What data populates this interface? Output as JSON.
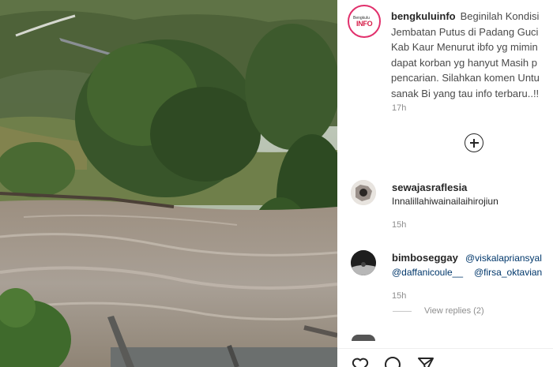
{
  "post": {
    "photo_label": "flooded river photo",
    "account": {
      "username": "bengkuluinfo",
      "brand_top": "Bengkulu",
      "brand_bottom": "INFO"
    },
    "caption_lines": [
      "Beginilah Kondisi",
      "Jembatan Putus di Padang Guci",
      "Kab Kaur Menurut ibfo yg mimin",
      "dapat korban yg hanyut Masih p",
      "pencarian. Silahkan komen Untu",
      "sanak Bi yang tau info terbaru..!!"
    ],
    "caption_time": "17h"
  },
  "comments": [
    {
      "username": "sewajasraflesia",
      "text": "Innalillahiwainailaihirojiun⁡",
      "time": "15h"
    },
    {
      "username": "bimboseggay",
      "mention1": "@viskalapriansyal",
      "mention2": "@daffanicoule__",
      "mention3": "@firsa_oktavian",
      "time": "15h",
      "view_replies": "View replies (2)"
    }
  ],
  "colors": {
    "ring": "#e1306c",
    "mention": "#00376b",
    "muted": "#8e8e8e"
  },
  "icons": [
    "plus-circle-icon",
    "heart-icon",
    "comment-icon",
    "share-icon"
  ]
}
